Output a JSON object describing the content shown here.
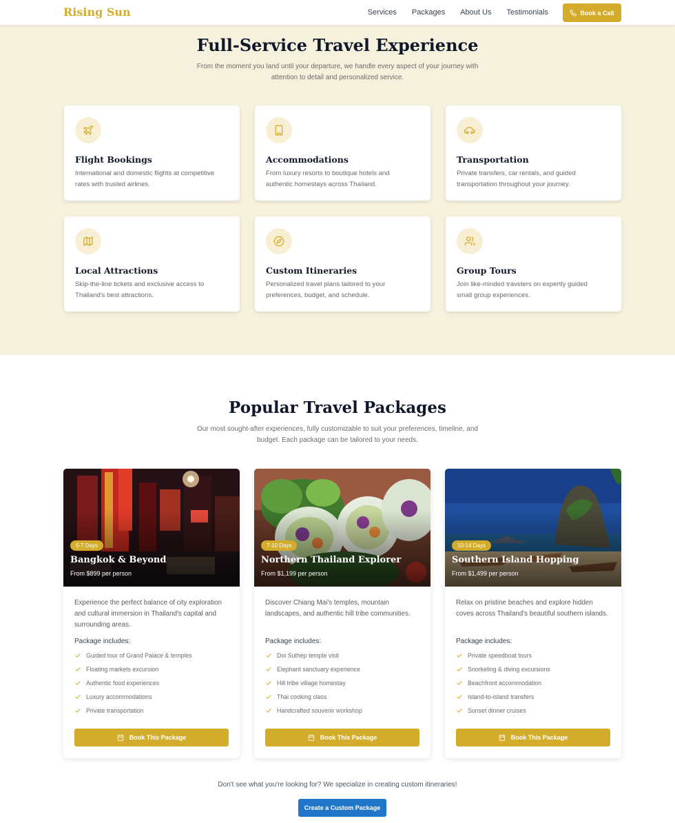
{
  "nav": {
    "brand": "Rising Sun",
    "links": [
      "Services",
      "Packages",
      "About Us",
      "Testimonials"
    ],
    "cta": "Book a Call"
  },
  "services": {
    "title": "Full-Service Travel Experience",
    "subtitle": "From the moment you land until your departure, we handle every aspect of your journey with attention to detail and personalized service.",
    "cards": [
      {
        "icon": "plane-icon",
        "title": "Flight Bookings",
        "desc": "International and domestic flights at competitive rates with trusted airlines."
      },
      {
        "icon": "building-icon",
        "title": "Accommodations",
        "desc": "From luxury resorts to boutique hotels and authentic homestays across Thailand."
      },
      {
        "icon": "car-icon",
        "title": "Transportation",
        "desc": "Private transfers, car rentals, and guided transportation throughout your journey."
      },
      {
        "icon": "map-icon",
        "title": "Local Attractions",
        "desc": "Skip-the-line tickets and exclusive access to Thailand's best attractions."
      },
      {
        "icon": "compass-icon",
        "title": "Custom Itineraries",
        "desc": "Personalized travel plans tailored to your preferences, budget, and schedule."
      },
      {
        "icon": "users-icon",
        "title": "Group Tours",
        "desc": "Join like-minded travelers on expertly guided small group experiences."
      }
    ]
  },
  "packages": {
    "title": "Popular Travel Packages",
    "subtitle": "Our most sought-after experiences, fully customizable to suit your preferences, timeline, and budget. Each package can be tailored to your needs.",
    "includes_label": "Package includes:",
    "button": "Book This Package",
    "items": [
      {
        "badge": "5-7 Days",
        "name": "Bangkok & Beyond",
        "price": "From $899 per person",
        "desc": "Experience the perfect balance of city exploration and cultural immersion in Thailand's capital and surrounding areas.",
        "includes": [
          "Guided tour of Grand Palace & temples",
          "Floating markets excursion",
          "Authentic food experiences",
          "Luxury accommodations",
          "Private transportation"
        ]
      },
      {
        "badge": "7-10 Days",
        "name": "Northern Thailand Explorer",
        "price": "From $1,199 per person",
        "desc": "Discover Chiang Mai's temples, mountain landscapes, and authentic hill tribe communities.",
        "includes": [
          "Doi Suthep temple visit",
          "Elephant sanctuary experience",
          "Hill tribe village homestay",
          "Thai cooking class",
          "Handcrafted souvenir workshop"
        ]
      },
      {
        "badge": "10-14 Days",
        "name": "Southern Island Hopping",
        "price": "From $1,499 per person",
        "desc": "Relax on pristine beaches and explore hidden coves across Thailand's beautiful southern islands.",
        "includes": [
          "Private speedboat tours",
          "Snorkeling & diving excursions",
          "Beachfront accommodation",
          "Island-to-island transfers",
          "Sunset dinner cruises"
        ]
      }
    ]
  },
  "footer_cta": {
    "note": "Don't see what you're looking for? We specialize in creating custom itineraries!",
    "button": "Create a Custom Package"
  },
  "colors": {
    "accent": "#d4ac2c",
    "cream": "#f6f1dd",
    "blue": "#2276c9"
  }
}
